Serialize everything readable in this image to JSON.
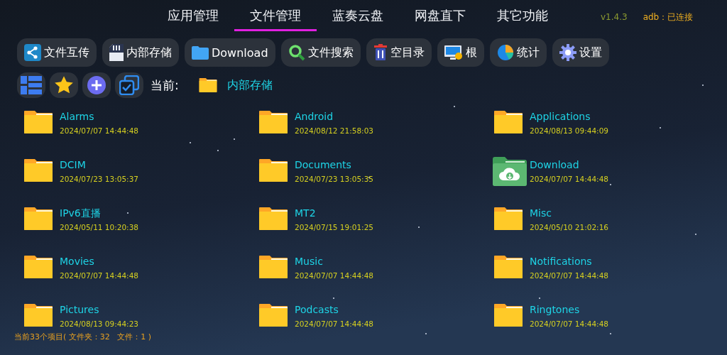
{
  "tabs": [
    {
      "label": "应用管理",
      "selected": false
    },
    {
      "label": "文件管理",
      "selected": true
    },
    {
      "label": "蓝奏云盘",
      "selected": false
    },
    {
      "label": "网盘直下",
      "selected": false
    },
    {
      "label": "其它功能",
      "selected": false
    }
  ],
  "version": "v1.4.3",
  "connection": "adb：已连接",
  "toolbar": [
    {
      "kind": "share",
      "label": "文件互传"
    },
    {
      "kind": "sdcard",
      "label": "内部存储"
    },
    {
      "kind": "folder",
      "label": "Download"
    },
    {
      "kind": "search",
      "label": "文件搜索"
    },
    {
      "kind": "trash",
      "label": "空目录"
    },
    {
      "kind": "monitor",
      "label": "根"
    },
    {
      "kind": "pie",
      "label": "统计"
    },
    {
      "kind": "gear",
      "label": "设置"
    }
  ],
  "actions": [
    {
      "kind": "list"
    },
    {
      "kind": "star"
    },
    {
      "kind": "add"
    },
    {
      "kind": "select"
    }
  ],
  "path": {
    "label": "当前:",
    "current": "内部存储"
  },
  "files": [
    {
      "kind": "folder",
      "name": "Alarms",
      "date": "2024/07/07 14:44:48"
    },
    {
      "kind": "folder",
      "name": "Android",
      "date": "2024/08/12 21:58:03"
    },
    {
      "kind": "folder",
      "name": "Applications",
      "date": "2024/08/13 09:44:09"
    },
    {
      "kind": "folder",
      "name": "DCIM",
      "date": "2024/07/23 13:05:37"
    },
    {
      "kind": "folder",
      "name": "Documents",
      "date": "2024/07/23 13:05:35"
    },
    {
      "kind": "download",
      "name": "Download",
      "date": "2024/07/07 14:44:48"
    },
    {
      "kind": "folder",
      "name": "IPv6直播",
      "date": "2024/05/11 10:20:38"
    },
    {
      "kind": "folder",
      "name": "MT2",
      "date": "2024/07/15 19:01:25"
    },
    {
      "kind": "folder",
      "name": "Misc",
      "date": "2024/05/10 21:02:16"
    },
    {
      "kind": "folder",
      "name": "Movies",
      "date": "2024/07/07 14:44:48"
    },
    {
      "kind": "folder",
      "name": "Music",
      "date": "2024/07/07 14:44:48"
    },
    {
      "kind": "folder",
      "name": "Notifications",
      "date": "2024/07/07 14:44:48"
    },
    {
      "kind": "folder",
      "name": "Pictures",
      "date": "2024/08/13 09:44:23"
    },
    {
      "kind": "folder",
      "name": "Podcasts",
      "date": "2024/07/07 14:44:48"
    },
    {
      "kind": "folder",
      "name": "Ringtones",
      "date": "2024/07/07 14:44:48"
    }
  ],
  "status_bar": "当前33个项目( 文件夹：32   文件：1 )"
}
